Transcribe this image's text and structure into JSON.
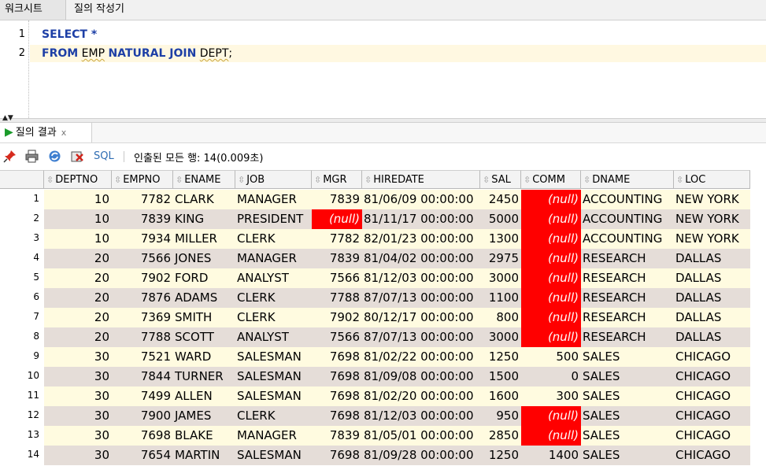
{
  "tabs": [
    "워크시트",
    "질의 작성기"
  ],
  "editor": {
    "line_numbers": [
      "1",
      "2"
    ],
    "line1": {
      "kw": "SELECT",
      "rest": " *"
    },
    "line2": {
      "kw1": "FROM",
      "t1": "EMP",
      "kw2": "NATURAL JOIN",
      "t2": "DEPT",
      "semi": ";"
    }
  },
  "results_tab": {
    "label": "질의 결과",
    "close": "x"
  },
  "toolbar": {
    "sql_label": "SQL",
    "fetch_status": "인출된 모든 행: 14(0.009초)"
  },
  "colors": {
    "row_yellow": "#fffbe0",
    "row_gray": "#e5ddd8",
    "null_bg": "#ff0000"
  },
  "grid": {
    "columns": [
      "DEPTNO",
      "EMPNO",
      "ENAME",
      "JOB",
      "MGR",
      "HIREDATE",
      "SAL",
      "COMM",
      "DNAME",
      "LOC"
    ],
    "rows": [
      [
        "1",
        "10",
        "7782",
        "CLARK",
        "MANAGER",
        "7839",
        "81/06/09 00:00:00",
        "2450",
        "(null)",
        "ACCOUNTING",
        "NEW YORK"
      ],
      [
        "2",
        "10",
        "7839",
        "KING",
        "PRESIDENT",
        "(null)",
        "81/11/17 00:00:00",
        "5000",
        "(null)",
        "ACCOUNTING",
        "NEW YORK"
      ],
      [
        "3",
        "10",
        "7934",
        "MILLER",
        "CLERK",
        "7782",
        "82/01/23 00:00:00",
        "1300",
        "(null)",
        "ACCOUNTING",
        "NEW YORK"
      ],
      [
        "4",
        "20",
        "7566",
        "JONES",
        "MANAGER",
        "7839",
        "81/04/02 00:00:00",
        "2975",
        "(null)",
        "RESEARCH",
        "DALLAS"
      ],
      [
        "5",
        "20",
        "7902",
        "FORD",
        "ANALYST",
        "7566",
        "81/12/03 00:00:00",
        "3000",
        "(null)",
        "RESEARCH",
        "DALLAS"
      ],
      [
        "6",
        "20",
        "7876",
        "ADAMS",
        "CLERK",
        "7788",
        "87/07/13 00:00:00",
        "1100",
        "(null)",
        "RESEARCH",
        "DALLAS"
      ],
      [
        "7",
        "20",
        "7369",
        "SMITH",
        "CLERK",
        "7902",
        "80/12/17 00:00:00",
        "800",
        "(null)",
        "RESEARCH",
        "DALLAS"
      ],
      [
        "8",
        "20",
        "7788",
        "SCOTT",
        "ANALYST",
        "7566",
        "87/07/13 00:00:00",
        "3000",
        "(null)",
        "RESEARCH",
        "DALLAS"
      ],
      [
        "9",
        "30",
        "7521",
        "WARD",
        "SALESMAN",
        "7698",
        "81/02/22 00:00:00",
        "1250",
        "500",
        "SALES",
        "CHICAGO"
      ],
      [
        "10",
        "30",
        "7844",
        "TURNER",
        "SALESMAN",
        "7698",
        "81/09/08 00:00:00",
        "1500",
        "0",
        "SALES",
        "CHICAGO"
      ],
      [
        "11",
        "30",
        "7499",
        "ALLEN",
        "SALESMAN",
        "7698",
        "81/02/20 00:00:00",
        "1600",
        "300",
        "SALES",
        "CHICAGO"
      ],
      [
        "12",
        "30",
        "7900",
        "JAMES",
        "CLERK",
        "7698",
        "81/12/03 00:00:00",
        "950",
        "(null)",
        "SALES",
        "CHICAGO"
      ],
      [
        "13",
        "30",
        "7698",
        "BLAKE",
        "MANAGER",
        "7839",
        "81/05/01 00:00:00",
        "2850",
        "(null)",
        "SALES",
        "CHICAGO"
      ],
      [
        "14",
        "30",
        "7654",
        "MARTIN",
        "SALESMAN",
        "7698",
        "81/09/28 00:00:00",
        "1250",
        "1400",
        "SALES",
        "CHICAGO"
      ]
    ]
  }
}
